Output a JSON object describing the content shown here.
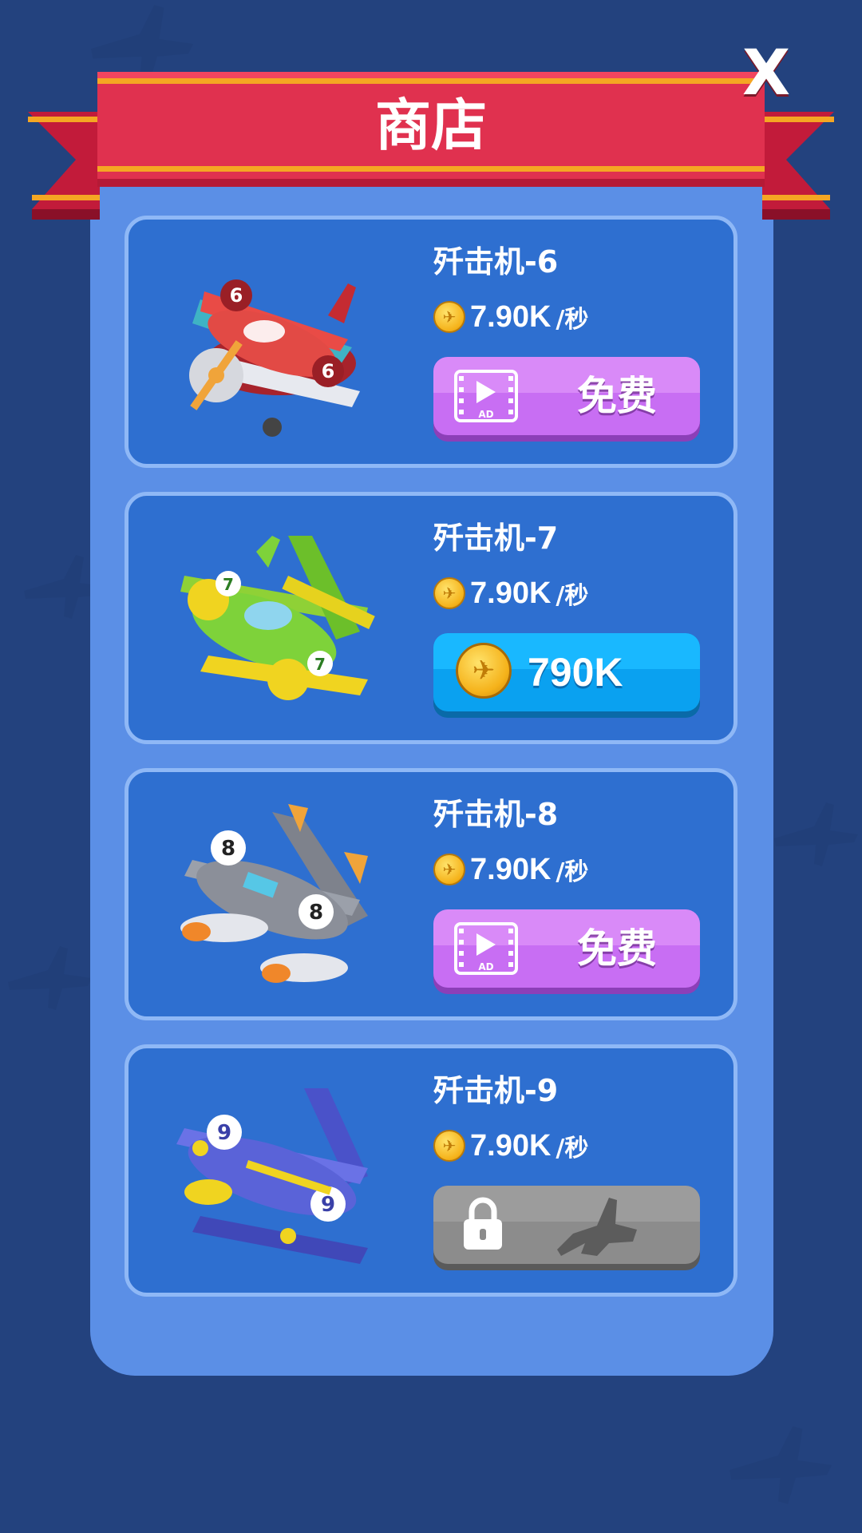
{
  "header": {
    "title": "商店",
    "close_label": "X"
  },
  "shop": {
    "items": [
      {
        "name": "歼击机-6",
        "rate_value": "7.90K",
        "rate_unit": "/秒",
        "action": "ad",
        "action_label": "免费",
        "ad_icon_text": "AD",
        "color": "#e0453f"
      },
      {
        "name": "歼击机-7",
        "rate_value": "7.90K",
        "rate_unit": "/秒",
        "action": "coin",
        "action_label": "790K",
        "color": "#7ed23a"
      },
      {
        "name": "歼击机-8",
        "rate_value": "7.90K",
        "rate_unit": "/秒",
        "action": "ad",
        "action_label": "免费",
        "ad_icon_text": "AD",
        "color": "#8b8f99"
      },
      {
        "name": "歼击机-9",
        "rate_value": "7.90K",
        "rate_unit": "/秒",
        "action": "locked",
        "color": "#5a63d8"
      }
    ]
  },
  "colors": {
    "background": "#23427e",
    "panel": "#5b8fe6",
    "card": "#2e6fd0",
    "ribbon": "#e0314f",
    "ad_button": "#c86ef3",
    "coin_button": "#0aa1f0",
    "locked_button": "#8c8c8c"
  }
}
